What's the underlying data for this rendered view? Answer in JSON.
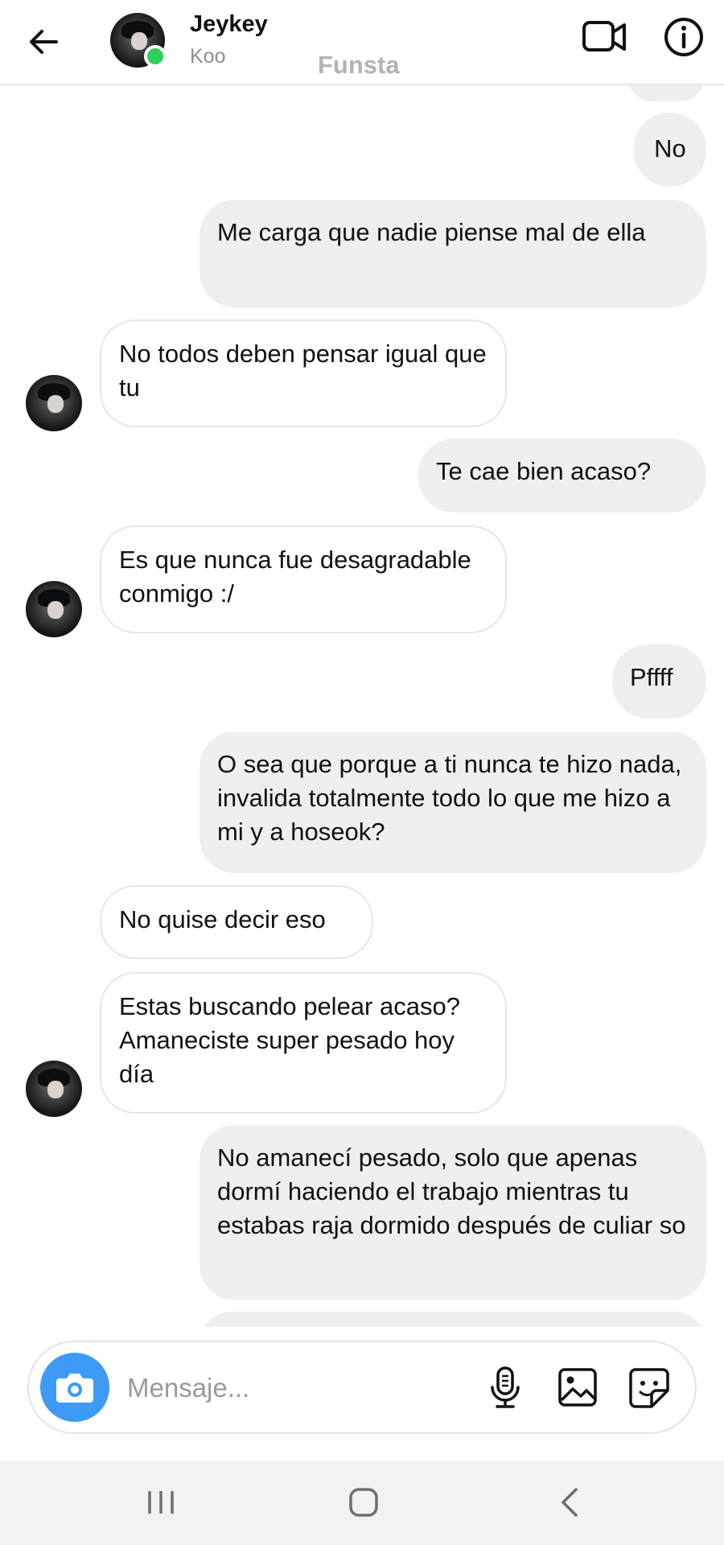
{
  "header": {
    "contact_name": "Jeykey",
    "contact_username": "Koo",
    "watermark": "Funsta",
    "online_color": "#2fd05a"
  },
  "messages": [
    {
      "sender": "me",
      "text": "No"
    },
    {
      "sender": "me",
      "text": "Me carga que nadie piense mal de ella"
    },
    {
      "sender": "them",
      "text": "No todos deben pensar igual que tu"
    },
    {
      "sender": "me",
      "text": "Te cae bien acaso?"
    },
    {
      "sender": "them",
      "text": "Es que nunca fue desagradable conmigo :/"
    },
    {
      "sender": "me",
      "text": "Pffff"
    },
    {
      "sender": "me",
      "text": "O sea que porque a ti nunca te hizo nada, invalida totalmente todo lo que me hizo a mi y a hoseok?"
    },
    {
      "sender": "them",
      "text": "No quise decir eso"
    },
    {
      "sender": "them",
      "text": "Estas buscando pelear acaso? Amaneciste super pesado hoy día"
    },
    {
      "sender": "me",
      "text": "No amanecí pesado, solo que apenas dormí haciendo el trabajo mientras tu estabas raja dormido después de culiar so"
    }
  ],
  "composer": {
    "placeholder": "Mensaje...",
    "camera_color": "#3d9bf6"
  },
  "icons": [
    "back-arrow-icon",
    "video-call-icon",
    "info-icon",
    "camera-icon",
    "microphone-icon",
    "gallery-icon",
    "sticker-icon",
    "recent-apps-icon",
    "home-icon",
    "nav-back-icon"
  ],
  "colors": {
    "my_bubble": "#efefef",
    "their_bubble_border": "#e6e6e6",
    "navbar": "#f2f2f2"
  }
}
